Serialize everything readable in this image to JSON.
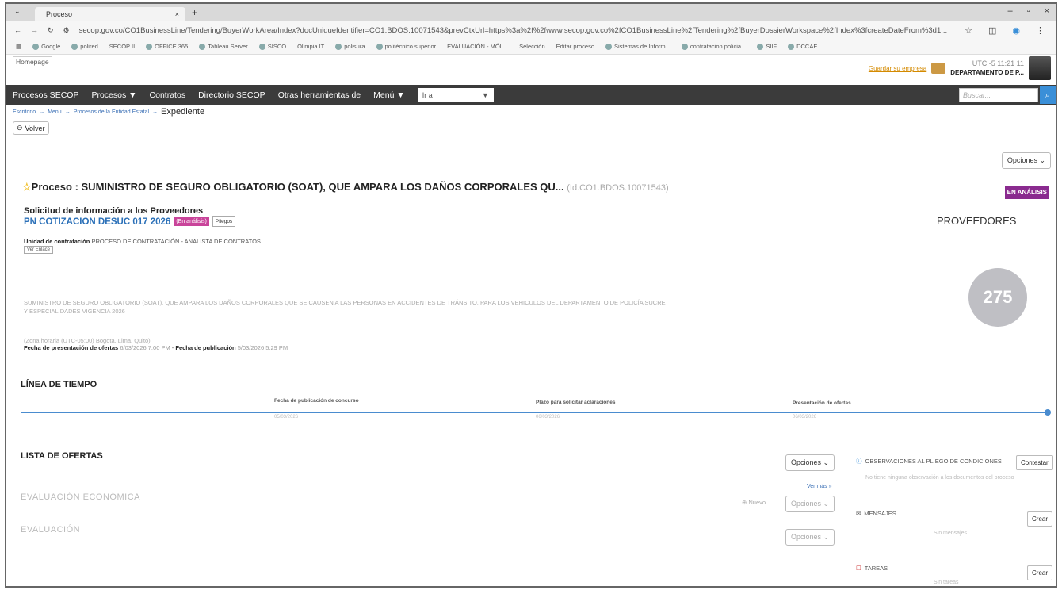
{
  "browser": {
    "tab_title": "Proceso",
    "tab_close": "×",
    "new_tab": "+",
    "url": "secop.gov.co/CO1BusinessLine/Tendering/BuyerWorkArea/Index?docUniqueIdentifier=CO1.BDOS.10071543&prevCtxUrl=https%3a%2f%2fwww.secop.gov.co%2fCO1BusinessLine%2fTendering%2fBuyerDossierWorkspace%2fIndex%3fcreateDateFrom%3d1...",
    "bookmarks": [
      "Google",
      "polired",
      "SECOP II",
      "OFFICE 365",
      "Tableau Server",
      "SISCO",
      "Olimpia IT",
      "polisura",
      "politécnico superior",
      "EVALUACIÓN - MÓL...",
      "Selección",
      "Editar proceso",
      "Sistemas de Inform...",
      "contratacion.policia...",
      "SIIF",
      "DCCAE"
    ]
  },
  "header": {
    "homepage": "Homepage",
    "buyer_link": "Guardar su empresa",
    "utc": "UTC -5 11:21 11",
    "department": "DEPARTAMENTO DE P..."
  },
  "menu": {
    "items": [
      "Procesos SECOP",
      "Procesos ▼",
      "Contratos",
      "Directorio SECOP",
      "Otras herramientas de",
      "Menú ▼"
    ],
    "goto_value": "Ir a",
    "search_placeholder": "Buscar..."
  },
  "breadcrumb": {
    "items": [
      "Escritorio",
      "Menu",
      "Procesos de la Entidad Estatal"
    ],
    "current": "Expediente"
  },
  "page": {
    "back_label": "Volver",
    "options_label": "Opciones ⌄",
    "process_prefix": "Proceso : ",
    "process_title": "SUMINISTRO DE SEGURO OBLIGATORIO (SOAT), QUE AMPARA LOS DAÑOS CORPORALES QU...",
    "process_id": "(Id.CO1.BDOS.10071543)",
    "status": "EN ANÁLISIS",
    "subtitle": "Solicitud de información a los Proveedores",
    "reference": "PN COTIZACION DESUC 017 2026",
    "ref_status": "(En análisis)",
    "pliegos": "Pliegos",
    "unit_label": "Unidad de contratación",
    "unit_value": "PROCESO DE CONTRATACIÓN - ANALISTA DE CONTRATOS",
    "ver_enlace": "Ver Enlace",
    "description_1": "SUMINISTRO DE SEGURO OBLIGATORIO (SOAT), QUE AMPARA LOS DAÑOS CORPORALES QUE SE CAUSEN A LAS PERSONAS EN ACCIDENTES DE TRÁNSITO, PARA LOS VEHICULOS DEL DEPARTAMENTO DE POLICÍA SUCRE",
    "description_2": "Y ESPECIALIDADES VIGENCIA 2026",
    "timezone": "(Zona horaria (UTC-05:00) Bogota, Lima, Quito)",
    "offers_label": "Fecha de presentación de ofertas",
    "offers_date": "6/03/2026 7:00 PM",
    "pub_sep": " - ",
    "pub_label": "Fecha de publicación",
    "pub_date": "5/03/2026 5:29 PM"
  },
  "providers": {
    "title": "PROVEEDORES",
    "count": "275"
  },
  "timeline": {
    "title": "LÍNEA DE TIEMPO",
    "steps": [
      {
        "label": "Fecha de publicación de concurso",
        "date": "05/03/2026"
      },
      {
        "label": "Plazo para solicitar aclaraciones",
        "date": "06/03/2026"
      },
      {
        "label": "Presentación de ofertas",
        "date": "06/03/2026"
      }
    ]
  },
  "offers": {
    "title": "LISTA DE OFERTAS",
    "options": "Opciones ⌄",
    "ver_mas": "Ver más »",
    "eval_econ": "EVALUACIÓN ECONÓMICA",
    "nuevo": "⊕ Nuevo",
    "eval_options": "Opciones ⌄",
    "evaluacion": "EVALUACIÓN",
    "eval2_options": "Opciones ⌄"
  },
  "side": {
    "obs_title": "OBSERVACIONES AL PLIEGO DE CONDICIONES",
    "obs_button": "Contestar",
    "obs_sub": "No tiene ninguna observación a los documentos del proceso",
    "msg_title": "MENSAJES",
    "msg_button": "Crear",
    "msg_sub": "Sin mensajes",
    "tasks_title": "TAREAS",
    "tasks_button": "Crear",
    "tasks_sub": "Sin tareas"
  }
}
